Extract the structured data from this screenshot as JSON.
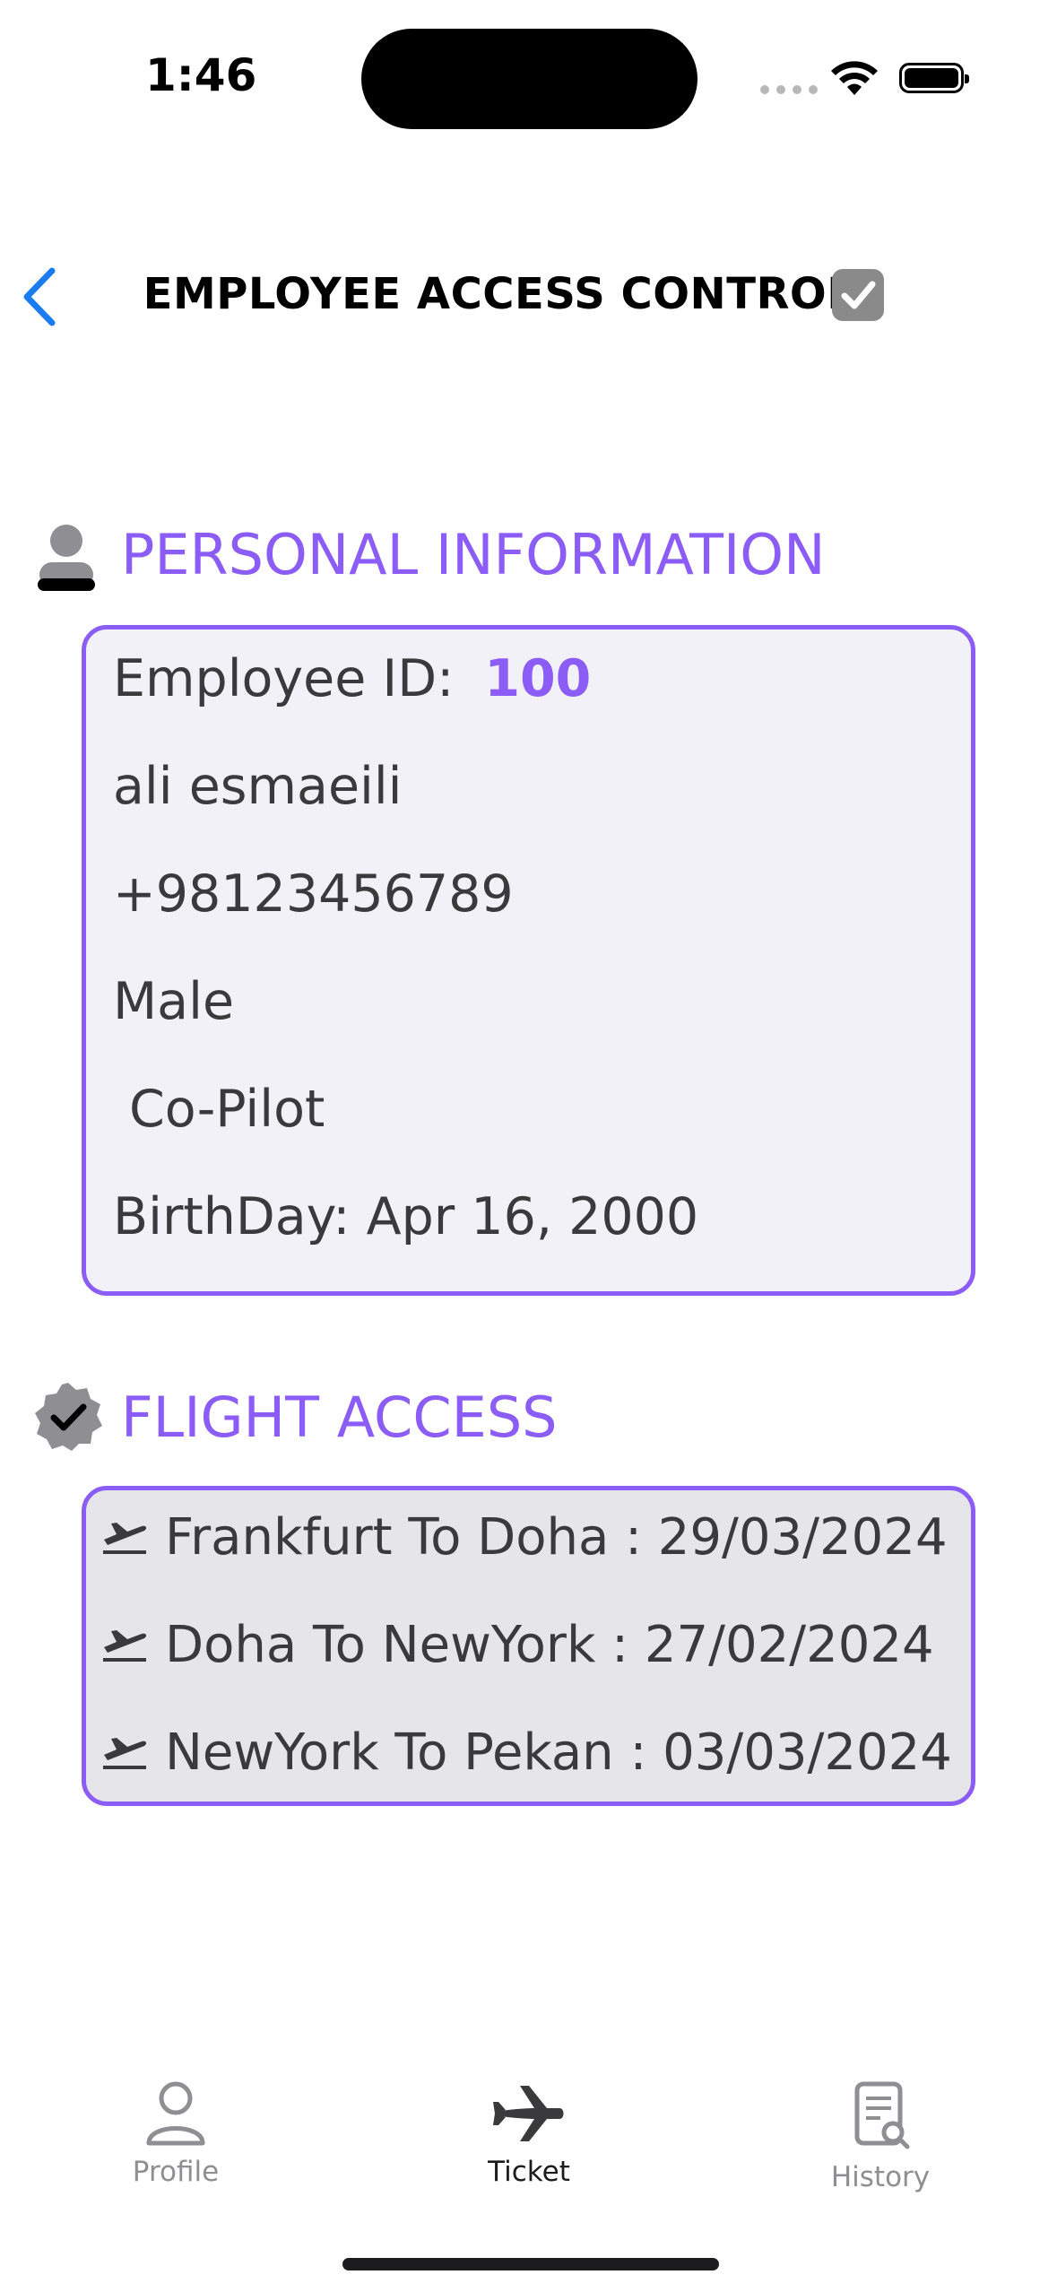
{
  "status_bar": {
    "time": "1:46"
  },
  "nav": {
    "title": "EMPLOYEE ACCESS CONTROL"
  },
  "personal": {
    "section_title": "PERSONAL INFORMATION",
    "employee_id_label": "Employee ID:",
    "employee_id": "100",
    "name": "ali esmaeili",
    "phone": "+98123456789",
    "gender": "Male",
    "role": "Co-Pilot",
    "birthday": "BirthDay: Apr 16, 2000"
  },
  "flight": {
    "section_title": "FLIGHT ACCESS",
    "items": [
      {
        "text": "Frankfurt To Doha : 29/03/2024"
      },
      {
        "text": "Doha To NewYork : 27/02/2024"
      },
      {
        "text": "NewYork To Pekan : 03/03/2024"
      }
    ]
  },
  "tabs": [
    {
      "label": "Profile",
      "icon": "person-icon",
      "active": false
    },
    {
      "label": "Ticket",
      "icon": "airplane-icon",
      "active": true
    },
    {
      "label": "History",
      "icon": "document-search-icon",
      "active": false
    }
  ],
  "colors": {
    "accent": "#8b5cf6",
    "back": "#1a7cf0",
    "inactive": "#8e8e93"
  }
}
